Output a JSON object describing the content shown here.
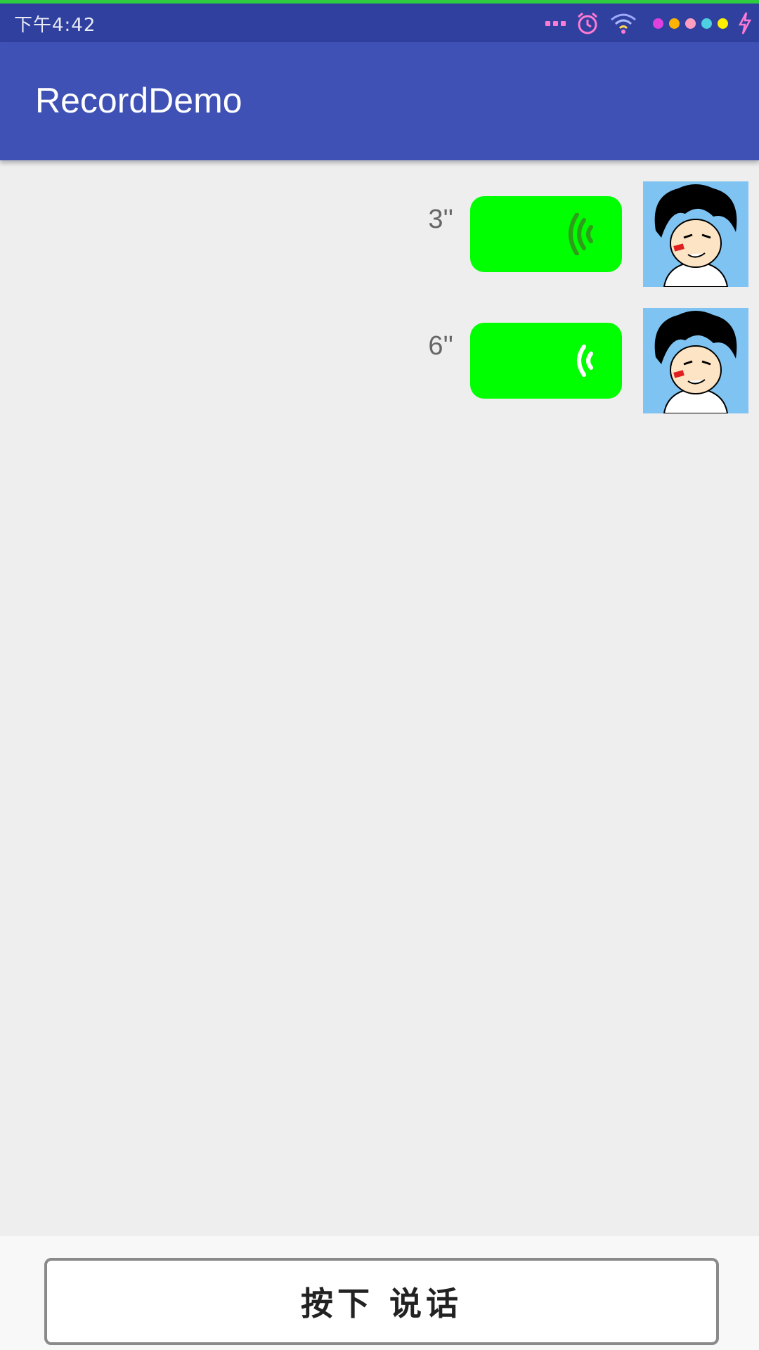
{
  "status_bar": {
    "time": "下午4:42",
    "icons": [
      "more-dots-icon",
      "alarm-icon",
      "wifi-icon",
      "notification-dots-icon",
      "charging-icon"
    ],
    "dot_colors": [
      "#e040e0",
      "#ffb300",
      "#ff9ec0",
      "#4dd0e1",
      "#ffee00"
    ]
  },
  "app_bar": {
    "title": "RecordDemo",
    "color": "#3f51b5"
  },
  "messages": [
    {
      "duration": "3''",
      "voice_icon": "voice-wave-icon",
      "icon_color": "#2e9e1a",
      "bubble_color": "#00ff00"
    },
    {
      "duration": "6''",
      "voice_icon": "voice-wave-icon",
      "icon_color": "#ffffff",
      "bubble_color": "#00ff00"
    }
  ],
  "record_button": {
    "label": "按下 说话"
  }
}
